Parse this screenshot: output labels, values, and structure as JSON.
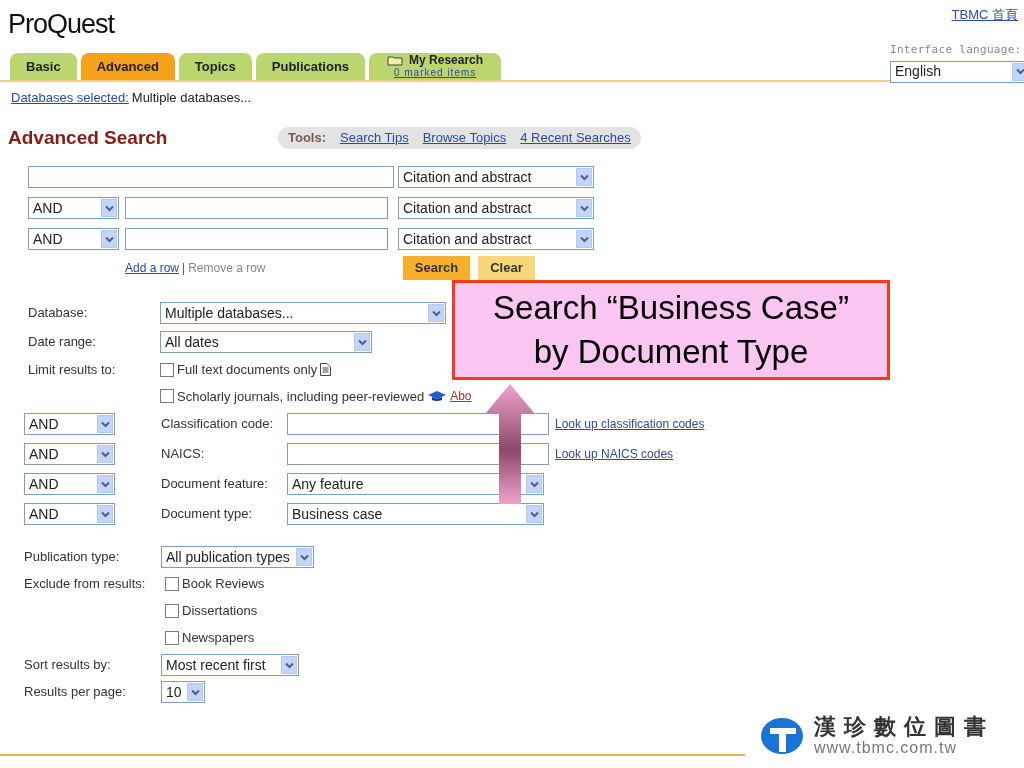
{
  "header": {
    "logo": "ProQuest",
    "home_link": "TBMC 首頁",
    "interface_language": {
      "label": "Interface language:",
      "value": "English"
    }
  },
  "tabs": [
    {
      "label": "Basic",
      "selected": false
    },
    {
      "label": "Advanced",
      "selected": true
    },
    {
      "label": "Topics",
      "selected": false
    },
    {
      "label": "Publications",
      "selected": false
    },
    {
      "label": "My Research",
      "selected": false,
      "sublink": "0 marked items"
    }
  ],
  "databases_selected": {
    "link": "Databases selected:",
    "value": "Multiple databases..."
  },
  "heading": "Advanced Search",
  "tools": {
    "label": "Tools:",
    "links": [
      "Search Tips",
      "Browse Topics",
      "4 Recent Searches"
    ]
  },
  "search_rows": [
    {
      "field": "Citation and abstract"
    },
    {
      "operator": "AND",
      "field": "Citation and abstract"
    },
    {
      "operator": "AND",
      "field": "Citation and abstract"
    }
  ],
  "row_actions": {
    "add": "Add a row",
    "separator": "|",
    "remove": "Remove a row"
  },
  "buttons": [
    "Search",
    "Clear"
  ],
  "limits": {
    "database": {
      "label": "Database:",
      "value": "Multiple databases..."
    },
    "date_range": {
      "label": "Date range:",
      "value": "All dates"
    },
    "limit_label": "Limit results to:",
    "options": [
      {
        "label": "Full text documents only",
        "checked": false
      },
      {
        "label": "Scholarly journals, including peer-reviewed",
        "checked": false
      }
    ],
    "about_link": "Abo"
  },
  "criteria": [
    {
      "operator": "AND",
      "label": "Classification code:",
      "kind": "input",
      "link": "Look up classification codes"
    },
    {
      "operator": "AND",
      "label": "NAICS:",
      "kind": "input",
      "link": "Look up NAICS codes"
    },
    {
      "operator": "AND",
      "label": "Document feature:",
      "kind": "select",
      "value": "Any feature"
    },
    {
      "operator": "AND",
      "label": "Document type:",
      "kind": "select",
      "value": "Business case"
    }
  ],
  "publication_type": {
    "label": "Publication type:",
    "value": "All publication types"
  },
  "exclude": {
    "label": "Exclude from results:",
    "options": [
      {
        "label": "Book Reviews",
        "checked": false
      },
      {
        "label": "Dissertations",
        "checked": false
      },
      {
        "label": "Newspapers",
        "checked": false
      }
    ]
  },
  "sort": {
    "label": "Sort results by:",
    "value": "Most recent first"
  },
  "per_page": {
    "label": "Results per page:",
    "value": "10"
  },
  "callout": {
    "lines": [
      "Search “Business Case”",
      "by Document Type"
    ]
  },
  "footer_logo": {
    "name": "漢珍數位圖書",
    "url": "www.tbmc.com.tw"
  }
}
